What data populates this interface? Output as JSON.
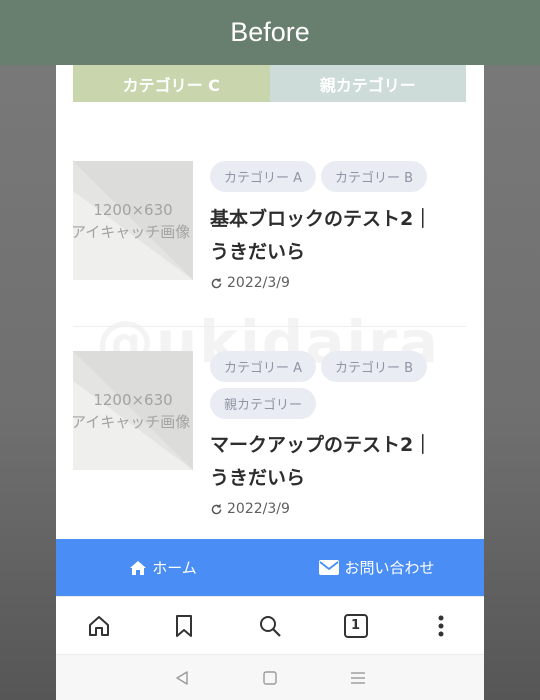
{
  "header": {
    "title": "Before"
  },
  "category_tabs": [
    {
      "label": "カテゴリー C",
      "color": "#c9d6ad"
    },
    {
      "label": "親カテゴリー",
      "color": "#cddbd9"
    }
  ],
  "watermark": "@ukidaira",
  "posts": [
    {
      "thumbnail": {
        "size_label": "1200×630",
        "caption": "アイキャッチ画像"
      },
      "tags": [
        "カテゴリー A",
        "カテゴリー B"
      ],
      "title": "基本ブロックのテスト2｜うきだいら",
      "date": "2022/3/9"
    },
    {
      "thumbnail": {
        "size_label": "1200×630",
        "caption": "アイキャッチ画像"
      },
      "tags": [
        "カテゴリー A",
        "カテゴリー B",
        "親カテゴリー"
      ],
      "title": "マークアップのテスト2｜うきだいら",
      "date": "2022/3/9"
    }
  ],
  "bottom_nav": {
    "home": {
      "label": "ホーム",
      "icon": "home-icon"
    },
    "contact": {
      "label": "お問い合わせ",
      "icon": "mail-icon"
    },
    "color": "#4a8ef5"
  },
  "browser_bar": {
    "tab_count": "1",
    "icons": [
      "home-icon",
      "bookmark-icon",
      "search-icon",
      "tabs-icon",
      "more-icon"
    ]
  },
  "system_nav": {
    "icons": [
      "back-icon",
      "home-square-icon",
      "recents-icon"
    ]
  }
}
